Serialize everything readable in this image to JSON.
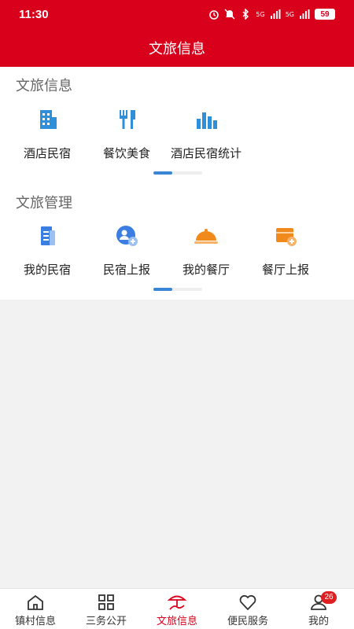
{
  "status_bar": {
    "time": "11:30",
    "signal_1": "5G",
    "signal_2": "5G",
    "battery": "59"
  },
  "header": {
    "title": "文旅信息"
  },
  "sections": [
    {
      "title": "文旅信息",
      "items": [
        {
          "label": "酒店民宿",
          "icon": "building-icon",
          "color": "#2f8fd8"
        },
        {
          "label": "餐饮美食",
          "icon": "fork-spoon-icon",
          "color": "#2f8fd8"
        },
        {
          "label": "酒店民宿统计",
          "icon": "bar-chart-icon",
          "color": "#2f8fd8"
        }
      ]
    },
    {
      "title": "文旅管理",
      "items": [
        {
          "label": "我的民宿",
          "icon": "document-icon",
          "color": "#3b7de0"
        },
        {
          "label": "民宿上报",
          "icon": "user-add-icon",
          "color": "#3b7de0"
        },
        {
          "label": "我的餐厅",
          "icon": "food-cloche-icon",
          "color": "#f08a1c"
        },
        {
          "label": "餐厅上报",
          "icon": "box-add-icon",
          "color": "#f08a1c"
        }
      ]
    }
  ],
  "tabbar": {
    "active_color": "#d9001b",
    "items": [
      {
        "label": "镇村信息",
        "icon": "home-icon"
      },
      {
        "label": "三务公开",
        "icon": "grid-icon"
      },
      {
        "label": "文旅信息",
        "icon": "tourism-icon",
        "active": true
      },
      {
        "label": "便民服务",
        "icon": "heart-icon"
      },
      {
        "label": "我的",
        "icon": "person-icon",
        "badge": "26"
      }
    ]
  }
}
